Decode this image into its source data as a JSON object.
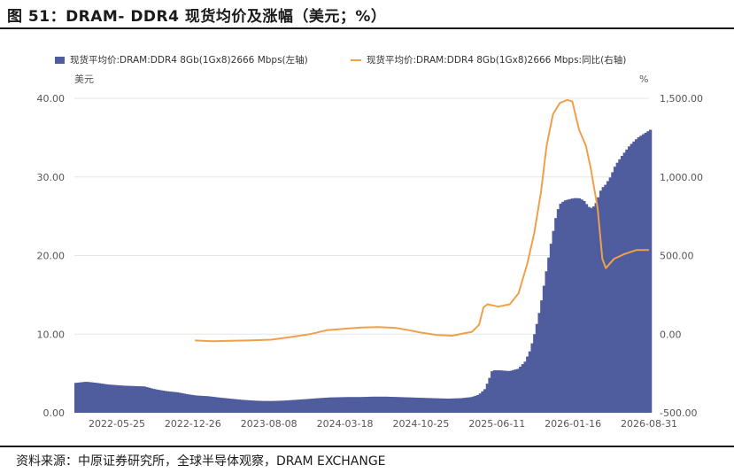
{
  "figure": {
    "title": "图 51：DRAM- DDR4 现货均价及涨幅（美元；%）",
    "source": "资料来源：中原证券研究所，全球半导体观察，DRAM EXCHANGE"
  },
  "chart_data": {
    "type": "bar+line",
    "left_axis": {
      "unit": "美元",
      "ylim": [
        0,
        40
      ],
      "ticks": [
        "0.00",
        "10.00",
        "20.00",
        "30.00",
        "40.00"
      ]
    },
    "right_axis": {
      "unit": "%",
      "ylim": [
        -500,
        1500
      ],
      "ticks": [
        "-500.00",
        "0.00",
        "500.00",
        "1,000.00",
        "1,500.00"
      ]
    },
    "x_ticks": [
      "2022-05-25",
      "2022-12-26",
      "2023-08-08",
      "2024-03-18",
      "2024-10-25",
      "2025-06-11",
      "2026-01-16",
      "2026-08-31"
    ],
    "x_range": [
      "2022-01-03",
      "2026-08-31"
    ],
    "grid": true,
    "legend_position": "top-left",
    "colors": {
      "bar": "#4f5c9e",
      "line": "#f0a04b",
      "grid": "#e6e6e6"
    },
    "series": [
      {
        "name": "现货平均价:DRAM:DDR4 8Gb(1Gx8)2666 Mbps(左轴)",
        "kind": "bar",
        "axis": "left",
        "points": [
          [
            "2022-01-03",
            3.8
          ],
          [
            "2022-02-03",
            3.95
          ],
          [
            "2022-03-07",
            3.8
          ],
          [
            "2022-04-08",
            3.6
          ],
          [
            "2022-05-25",
            3.45
          ],
          [
            "2022-06-24",
            3.4
          ],
          [
            "2022-07-25",
            3.35
          ],
          [
            "2022-08-25",
            3.0
          ],
          [
            "2022-09-28",
            2.75
          ],
          [
            "2022-11-01",
            2.6
          ],
          [
            "2022-12-01",
            2.35
          ],
          [
            "2022-12-26",
            2.2
          ],
          [
            "2023-02-01",
            2.1
          ],
          [
            "2023-03-01",
            1.95
          ],
          [
            "2023-04-05",
            1.8
          ],
          [
            "2023-05-10",
            1.65
          ],
          [
            "2023-06-14",
            1.55
          ],
          [
            "2023-07-12",
            1.5
          ],
          [
            "2023-08-08",
            1.5
          ],
          [
            "2023-09-12",
            1.55
          ],
          [
            "2023-10-18",
            1.65
          ],
          [
            "2023-11-20",
            1.75
          ],
          [
            "2023-12-20",
            1.85
          ],
          [
            "2024-01-25",
            1.95
          ],
          [
            "2024-03-18",
            2.0
          ],
          [
            "2024-04-25",
            2.0
          ],
          [
            "2024-06-01",
            2.05
          ],
          [
            "2024-07-08",
            2.05
          ],
          [
            "2024-08-15",
            2.0
          ],
          [
            "2024-09-20",
            1.95
          ],
          [
            "2024-10-25",
            1.9
          ],
          [
            "2024-12-01",
            1.85
          ],
          [
            "2025-01-10",
            1.8
          ],
          [
            "2025-02-15",
            1.85
          ],
          [
            "2025-03-20",
            2.0
          ],
          [
            "2025-04-10",
            2.3
          ],
          [
            "2025-04-28",
            3.0
          ],
          [
            "2025-05-10",
            4.2
          ],
          [
            "2025-05-20",
            5.4
          ],
          [
            "2025-06-11",
            5.4
          ],
          [
            "2025-07-10",
            5.3
          ],
          [
            "2025-08-05",
            5.6
          ],
          [
            "2025-08-25",
            6.5
          ],
          [
            "2025-09-10",
            8.0
          ],
          [
            "2025-09-25",
            10.5
          ],
          [
            "2025-10-10",
            13.5
          ],
          [
            "2025-10-25",
            17.5
          ],
          [
            "2025-11-10",
            21.5
          ],
          [
            "2025-11-25",
            25.0
          ],
          [
            "2025-12-05",
            26.5
          ],
          [
            "2025-12-20",
            27.0
          ],
          [
            "2026-01-16",
            27.3
          ],
          [
            "2026-02-01",
            27.3
          ],
          [
            "2026-02-15",
            27.0
          ],
          [
            "2026-03-01",
            26.2
          ],
          [
            "2026-03-12",
            26.0
          ],
          [
            "2026-03-25",
            26.8
          ],
          [
            "2026-04-08",
            28.5
          ],
          [
            "2026-04-20",
            29.0
          ],
          [
            "2026-05-05",
            30.0
          ],
          [
            "2026-05-20",
            31.5
          ],
          [
            "2026-06-10",
            32.8
          ],
          [
            "2026-07-01",
            34.0
          ],
          [
            "2026-07-25",
            35.0
          ],
          [
            "2026-08-31",
            36.0
          ]
        ]
      },
      {
        "name": "现货平均价:DRAM:DDR4 8Gb(1Gx8)2666 Mbps:同比(右轴)",
        "kind": "line",
        "axis": "right",
        "points": [
          [
            "2022-12-26",
            -40
          ],
          [
            "2023-02-15",
            -45
          ],
          [
            "2023-04-10",
            -42
          ],
          [
            "2023-06-01",
            -40
          ],
          [
            "2023-08-08",
            -35
          ],
          [
            "2023-10-01",
            -20
          ],
          [
            "2023-12-01",
            0
          ],
          [
            "2024-01-20",
            25
          ],
          [
            "2024-03-18",
            35
          ],
          [
            "2024-05-01",
            42
          ],
          [
            "2024-06-20",
            45
          ],
          [
            "2024-08-10",
            40
          ],
          [
            "2024-09-20",
            25
          ],
          [
            "2024-10-25",
            10
          ],
          [
            "2024-12-10",
            -5
          ],
          [
            "2025-01-25",
            -10
          ],
          [
            "2025-03-01",
            5
          ],
          [
            "2025-03-25",
            15
          ],
          [
            "2025-04-15",
            60
          ],
          [
            "2025-04-28",
            170
          ],
          [
            "2025-05-10",
            190
          ],
          [
            "2025-06-11",
            175
          ],
          [
            "2025-07-15",
            190
          ],
          [
            "2025-08-10",
            260
          ],
          [
            "2025-09-05",
            450
          ],
          [
            "2025-09-25",
            640
          ],
          [
            "2025-10-15",
            900
          ],
          [
            "2025-11-01",
            1200
          ],
          [
            "2025-11-20",
            1400
          ],
          [
            "2025-12-10",
            1470
          ],
          [
            "2026-01-01",
            1490
          ],
          [
            "2026-01-16",
            1480
          ],
          [
            "2026-02-05",
            1300
          ],
          [
            "2026-02-25",
            1200
          ],
          [
            "2026-03-12",
            1050
          ],
          [
            "2026-04-01",
            800
          ],
          [
            "2026-04-15",
            480
          ],
          [
            "2026-04-25",
            420
          ],
          [
            "2026-05-20",
            480
          ],
          [
            "2026-06-20",
            510
          ],
          [
            "2026-07-25",
            535
          ],
          [
            "2026-08-31",
            535
          ]
        ]
      }
    ]
  }
}
